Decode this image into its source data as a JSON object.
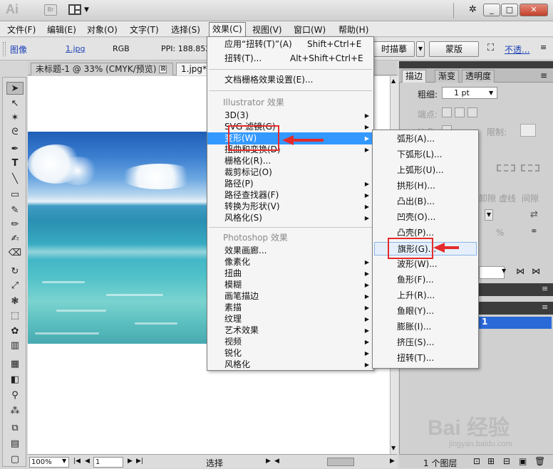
{
  "titlebar": {
    "logo": "Ai",
    "bridge_label": "Br",
    "window_buttons": [
      "_",
      "□",
      "✕"
    ]
  },
  "menubar": {
    "items": [
      "文件(F)",
      "编辑(E)",
      "对象(O)",
      "文字(T)",
      "选择(S)",
      "效果(C)",
      "视图(V)",
      "窗口(W)",
      "帮助(H)"
    ]
  },
  "controlbar": {
    "image_label": "图像",
    "file_name": "1.jpg",
    "color_mode": "RGB",
    "ppi": "PPI: 188.852x2",
    "live_trace_button": "时描摹",
    "mask_button": "蒙版",
    "opacity_link": "不透..."
  },
  "document": {
    "tab1_title": "未标题-1 @ 33% (CMYK/预览)",
    "tab1_close": "⊠",
    "tab2_title": "1.jpg*",
    "zoom": "100%",
    "page": "1",
    "status": "选择"
  },
  "effect_menu": {
    "apply_last": "应用“扭转(T)”(A)",
    "apply_last_shortcut": "Shift+Ctrl+E",
    "last_effect": "扭转(T)...",
    "last_effect_shortcut": "Alt+Shift+Ctrl+E",
    "raster_settings": "文档栅格效果设置(E)...",
    "illustrator_group": "Illustrator 效果",
    "illustrator_items": [
      "3D(3)",
      "SVG 滤镜(G)",
      "变形(W)",
      "扭曲和变换(D)",
      "栅格化(R)...",
      "裁剪标记(O)",
      "路径(P)",
      "路径查找器(F)",
      "转换为形状(V)",
      "风格化(S)"
    ],
    "photoshop_group": "Photoshop 效果",
    "photoshop_items": [
      "效果画廊...",
      "像素化",
      "扭曲",
      "模糊",
      "画笔描边",
      "素描",
      "纹理",
      "艺术效果",
      "视频",
      "锐化",
      "风格化"
    ]
  },
  "warp_menu": {
    "items": [
      "弧形(A)...",
      "下弧形(L)...",
      "上弧形(U)...",
      "拱形(H)...",
      "凸出(B)...",
      "凹壳(O)...",
      "凸壳(P)...",
      "旗形(G)...",
      "波形(W)...",
      "鱼形(F)...",
      "上升(R)...",
      "鱼眼(Y)...",
      "膨胀(I)...",
      "挤压(S)...",
      "扭转(T)..."
    ]
  },
  "right_panel": {
    "tabs": [
      "描边",
      "渐变",
      "透明度"
    ],
    "weight_label": "粗细:",
    "weight_value": "1 pt",
    "cap_label": "端点:",
    "join_label": "边角:",
    "limit_label": "限制:",
    "dash_label": "虚线",
    "gap_label": "间隙",
    "dash_prefix": "卸隙",
    "percent": "%",
    "layer_name": "1",
    "layer_count": "1 个图层"
  },
  "watermark": {
    "brand": "Bai 经验",
    "url": "jingyan.baidu.com"
  },
  "colors": {
    "menu_highlight": "#3399ff",
    "annotation_red": "#e52b2b",
    "layer_selected": "#2a6ad8"
  }
}
